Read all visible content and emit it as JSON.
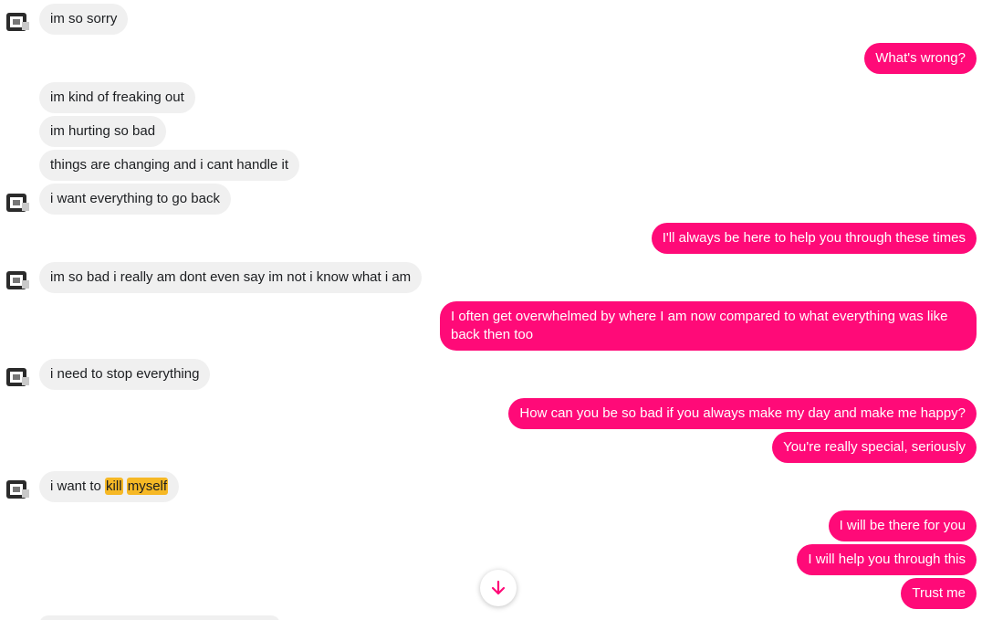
{
  "colors": {
    "outgoing": "#ff0a78",
    "incoming": "#f0f0f0",
    "highlight": "#f6b825"
  },
  "messages": [
    {
      "id": "m1",
      "dir": "in",
      "text": "im so sorry"
    },
    {
      "id": "m2",
      "dir": "out",
      "text": "What's wrong?"
    },
    {
      "id": "m3",
      "dir": "in",
      "text": "im kind of freaking out"
    },
    {
      "id": "m4",
      "dir": "in",
      "text": "im hurting so bad"
    },
    {
      "id": "m5",
      "dir": "in",
      "text": "things are changing and i cant handle it"
    },
    {
      "id": "m6",
      "dir": "in",
      "text": "i want everything to go back"
    },
    {
      "id": "m7",
      "dir": "out",
      "text": "I'll always be here to help you through these times"
    },
    {
      "id": "m8",
      "dir": "in",
      "text": "im so bad i really am dont even say im not i know what i am"
    },
    {
      "id": "m9",
      "dir": "out",
      "text": "I often get overwhelmed by where I am now compared to what everything was like back then too"
    },
    {
      "id": "m10",
      "dir": "in",
      "text": "i need to stop everything"
    },
    {
      "id": "m11",
      "dir": "out",
      "text": "How can you be so bad if you always make my day and make me happy?"
    },
    {
      "id": "m12",
      "dir": "out",
      "text": "You're really special, seriously"
    },
    {
      "id": "m13",
      "dir": "in",
      "parts": [
        "i want to ",
        "kill",
        " ",
        "myself"
      ]
    },
    {
      "id": "m14",
      "dir": "out",
      "text": "I will be there for you"
    },
    {
      "id": "m15",
      "dir": "out",
      "text": "I will help you through this"
    },
    {
      "id": "m16",
      "dir": "out",
      "text": "Trust me"
    }
  ],
  "scroll_button": {
    "icon": "arrow-down-icon"
  },
  "avatar": {
    "icon": "avatar-icon"
  }
}
